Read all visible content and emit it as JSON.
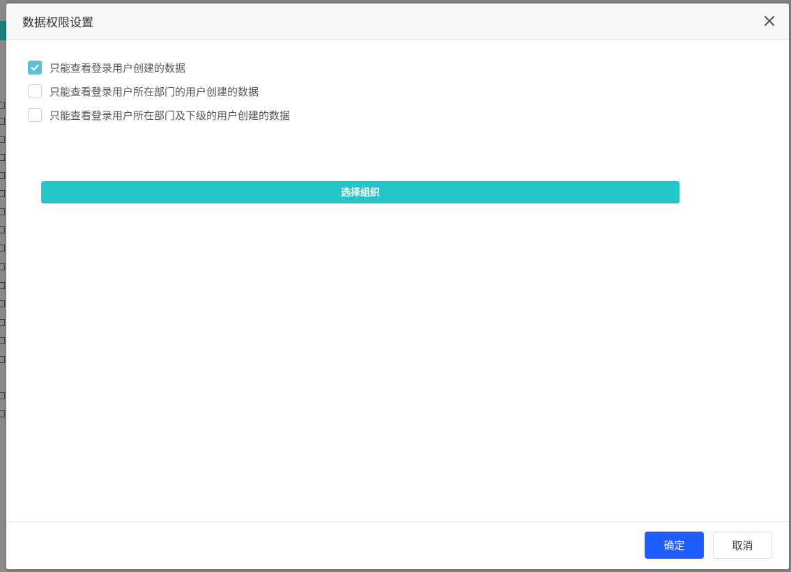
{
  "dialog": {
    "title": "数据权限设置",
    "close_icon": "close-icon"
  },
  "options": [
    {
      "label": "只能查看登录用户创建的数据",
      "checked": true
    },
    {
      "label": "只能查看登录用户所在部门的用户创建的数据",
      "checked": false
    },
    {
      "label": "只能查看登录用户所在部门及下级的用户创建的数据",
      "checked": false
    }
  ],
  "select_org": {
    "label": "选择组织",
    "color": "#26c6c8"
  },
  "footer": {
    "confirm_label": "确定",
    "cancel_label": "取消",
    "confirm_color": "#1e5eff"
  },
  "colors": {
    "checkbox_checked": "#5bc0de"
  }
}
